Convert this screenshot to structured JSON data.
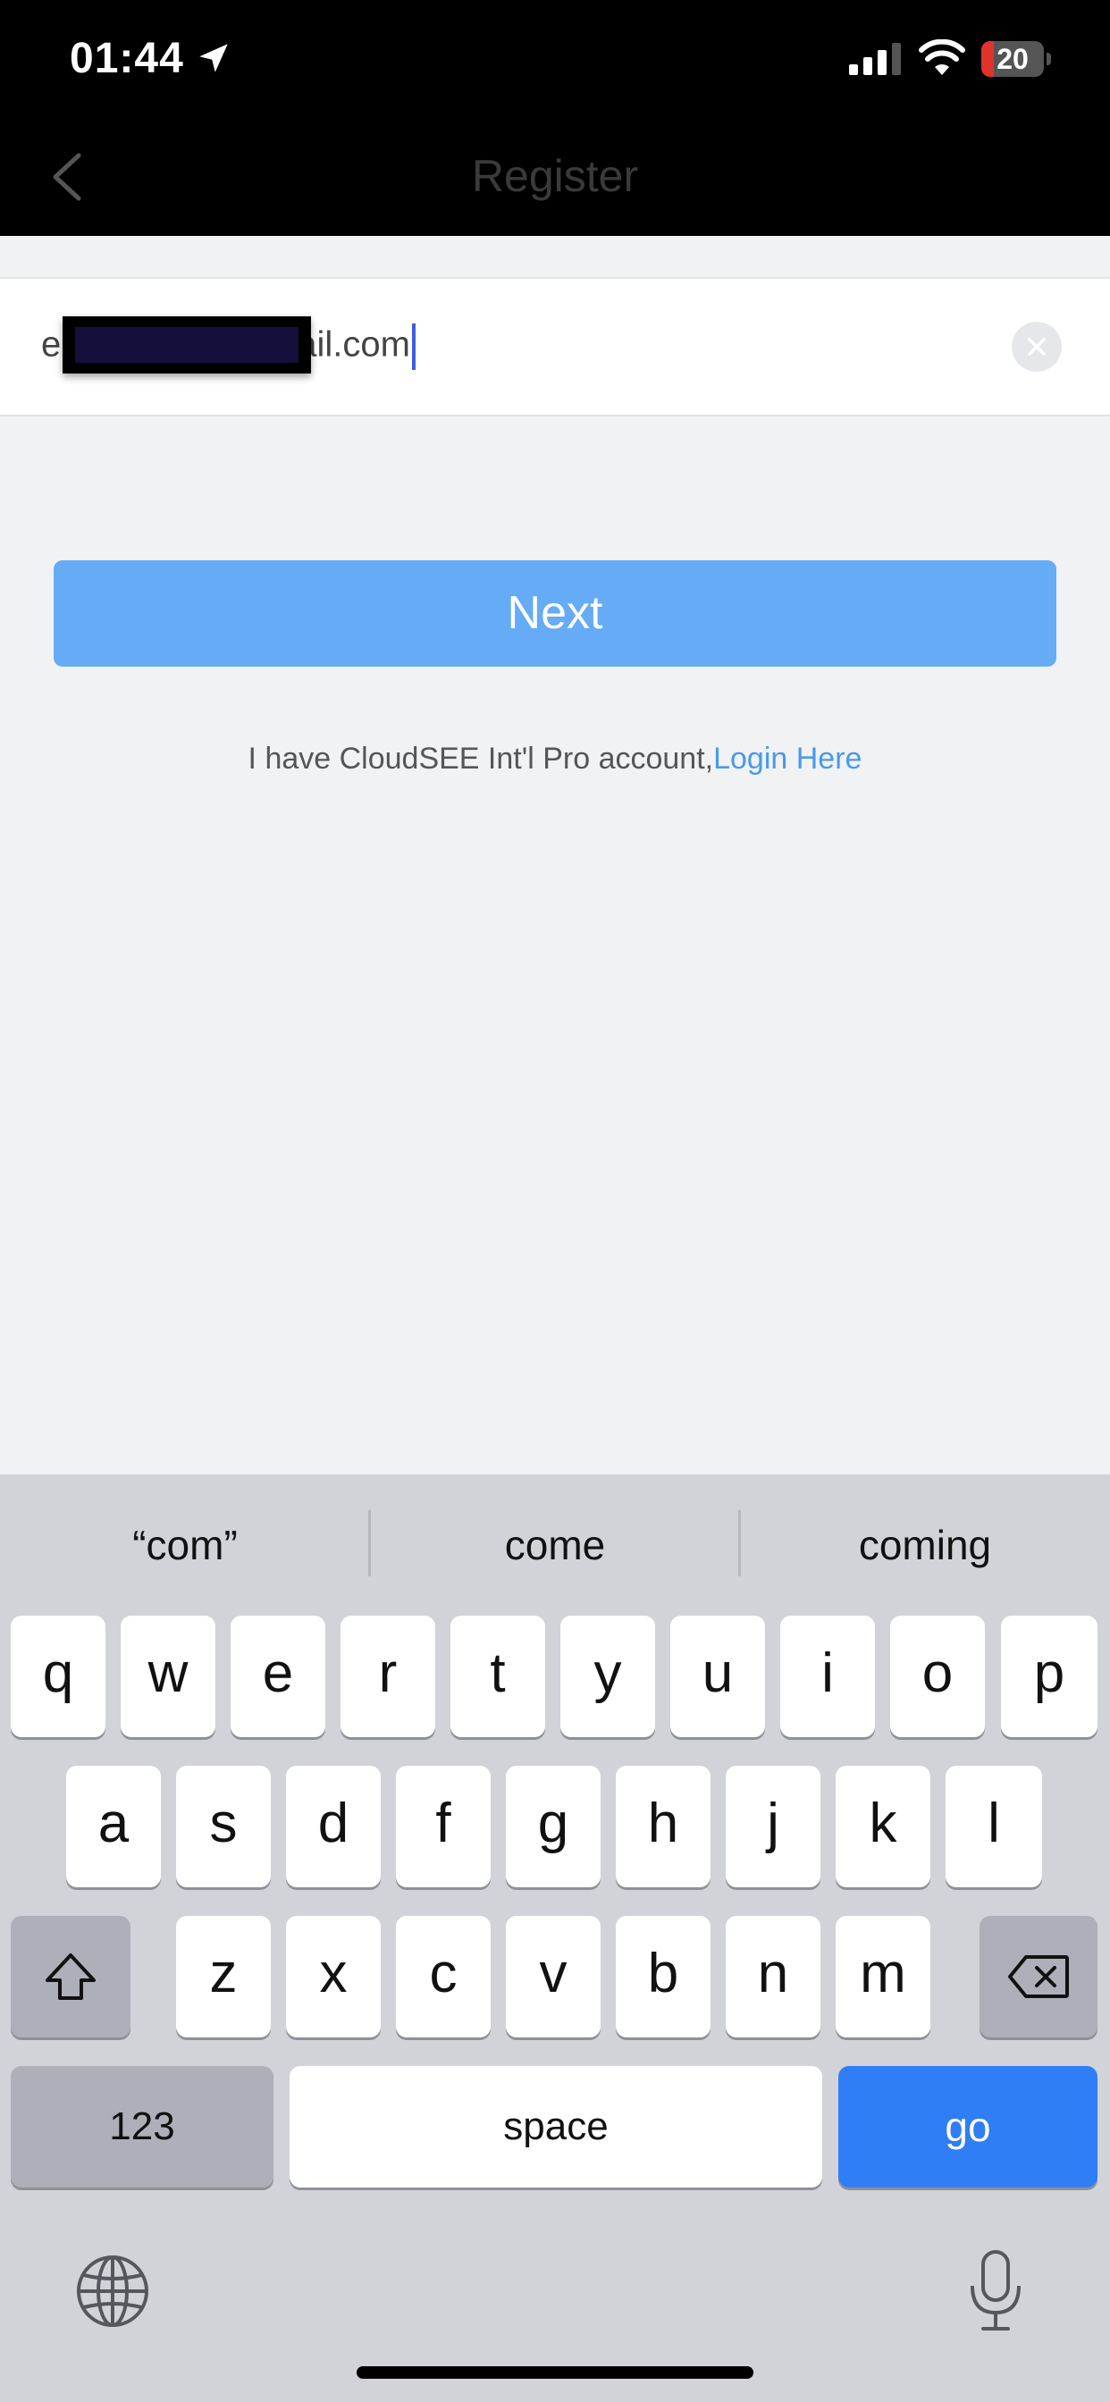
{
  "status_bar": {
    "time": "01:44",
    "battery_level": "20",
    "battery_fraction": 0.2,
    "battery_color": "#e0332b"
  },
  "nav": {
    "title": "Register"
  },
  "email_field": {
    "value_prefix": "e",
    "value_suffix": "ail.com"
  },
  "next_button": {
    "label": "Next",
    "color": "#66abf6"
  },
  "login_prompt": {
    "text": "I have CloudSEE Int'l Pro account,",
    "link": "Login Here"
  },
  "keyboard": {
    "suggestions": [
      "“com”",
      "come",
      "coming"
    ],
    "row1": [
      "q",
      "w",
      "e",
      "r",
      "t",
      "y",
      "u",
      "i",
      "o",
      "p"
    ],
    "row2": [
      "a",
      "s",
      "d",
      "f",
      "g",
      "h",
      "j",
      "k",
      "l"
    ],
    "row3": [
      "z",
      "x",
      "c",
      "v",
      "b",
      "n",
      "m"
    ],
    "numbers_key": "123",
    "space_key": "space",
    "go_key": "go",
    "go_color": "#2f7ef6"
  },
  "icons": [
    "location-arrow-icon",
    "signal-icon",
    "wifi-icon",
    "battery-icon",
    "back-chevron-icon",
    "clear-icon",
    "shift-icon",
    "backspace-icon",
    "globe-icon",
    "microphone-icon"
  ]
}
